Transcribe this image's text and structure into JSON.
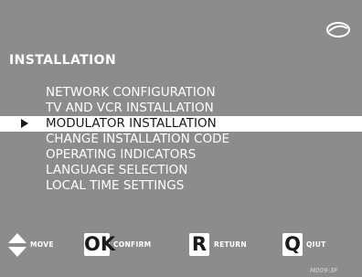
{
  "screen": {
    "title": "INSTALLATION"
  },
  "menu": {
    "items": [
      {
        "label": "NETWORK CONFIGURATION",
        "selected": false
      },
      {
        "label": "TV AND VCR INSTALLATION",
        "selected": false
      },
      {
        "label": "MODULATOR INSTALLATION",
        "selected": true
      },
      {
        "label": "CHANGE INSTALLATION CODE",
        "selected": false
      },
      {
        "label": "OPERATING INDICATORS",
        "selected": false
      },
      {
        "label": "LANGUAGE SELECTION",
        "selected": false
      },
      {
        "label": "LOCAL TIME SETTINGS",
        "selected": false
      }
    ]
  },
  "legend": {
    "move": {
      "icon": "up-down-arrows-icon",
      "label": "MOVE"
    },
    "confirm": {
      "key": "OK",
      "label": "CONFIRM"
    },
    "return": {
      "key": "R",
      "label": "RETURN"
    },
    "quit": {
      "key": "Q",
      "label": "QIUT"
    }
  },
  "footer": {
    "code": "M009-3F"
  },
  "colors": {
    "background": "#8c8c8c",
    "text": "#ffffff",
    "highlight_bg": "#ffffff",
    "highlight_text": "#1a1a1a"
  }
}
